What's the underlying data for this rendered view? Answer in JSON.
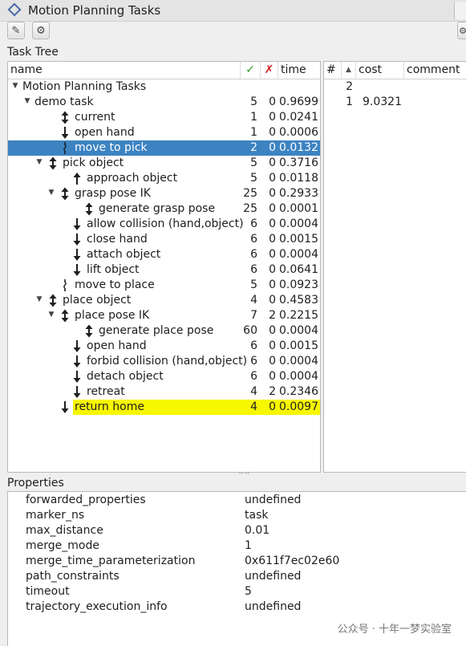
{
  "window": {
    "title": "Motion Planning Tasks"
  },
  "toolbar": {
    "edit_icon": "edit-icon",
    "settings_icon": "gear-icon"
  },
  "task_tree": {
    "label": "Task Tree",
    "columns": {
      "name": "name",
      "ok": "✓",
      "fail": "✗",
      "time": "time"
    },
    "rows": [
      {
        "name": "Motion Planning Tasks",
        "depth": 0,
        "expander": "▼",
        "icon": "",
        "ok": "",
        "fail": "",
        "time": "",
        "state": ""
      },
      {
        "name": "demo task",
        "depth": 1,
        "expander": "▼",
        "icon": "",
        "ok": "5",
        "fail": "0",
        "time": "0.9699",
        "state": ""
      },
      {
        "name": "current",
        "depth": 3,
        "expander": "",
        "icon": "both",
        "ok": "1",
        "fail": "0",
        "time": "0.0241",
        "state": ""
      },
      {
        "name": "open hand",
        "depth": 3,
        "expander": "",
        "icon": "down",
        "ok": "1",
        "fail": "0",
        "time": "0.0006",
        "state": ""
      },
      {
        "name": "move to pick",
        "depth": 3,
        "expander": "",
        "icon": "connect",
        "ok": "2",
        "fail": "0",
        "time": "0.0132",
        "state": "selected"
      },
      {
        "name": "pick object",
        "depth": 2,
        "expander": "▼",
        "icon": "both",
        "ok": "5",
        "fail": "0",
        "time": "0.3716",
        "state": ""
      },
      {
        "name": "approach object",
        "depth": 4,
        "expander": "",
        "icon": "up",
        "ok": "5",
        "fail": "0",
        "time": "0.0118",
        "state": ""
      },
      {
        "name": "grasp pose IK",
        "depth": 3,
        "expander": "▼",
        "icon": "both",
        "ok": "25",
        "fail": "0",
        "time": "0.2933",
        "state": ""
      },
      {
        "name": "generate grasp pose",
        "depth": 5,
        "expander": "",
        "icon": "both",
        "ok": "25",
        "fail": "0",
        "time": "0.0001",
        "state": ""
      },
      {
        "name": "allow collision (hand,object)",
        "depth": 4,
        "expander": "",
        "icon": "down",
        "ok": "6",
        "fail": "0",
        "time": "0.0004",
        "state": ""
      },
      {
        "name": "close hand",
        "depth": 4,
        "expander": "",
        "icon": "down",
        "ok": "6",
        "fail": "0",
        "time": "0.0015",
        "state": ""
      },
      {
        "name": "attach object",
        "depth": 4,
        "expander": "",
        "icon": "down",
        "ok": "6",
        "fail": "0",
        "time": "0.0004",
        "state": ""
      },
      {
        "name": "lift object",
        "depth": 4,
        "expander": "",
        "icon": "down",
        "ok": "6",
        "fail": "0",
        "time": "0.0641",
        "state": ""
      },
      {
        "name": "move to place",
        "depth": 3,
        "expander": "",
        "icon": "connect",
        "ok": "5",
        "fail": "0",
        "time": "0.0923",
        "state": ""
      },
      {
        "name": "place object",
        "depth": 2,
        "expander": "▼",
        "icon": "both",
        "ok": "4",
        "fail": "0",
        "time": "0.4583",
        "state": ""
      },
      {
        "name": "place pose IK",
        "depth": 3,
        "expander": "▼",
        "icon": "both",
        "ok": "7",
        "fail": "2",
        "time": "0.2215",
        "state": ""
      },
      {
        "name": "generate place pose",
        "depth": 5,
        "expander": "",
        "icon": "both",
        "ok": "60",
        "fail": "0",
        "time": "0.0004",
        "state": ""
      },
      {
        "name": "open hand",
        "depth": 4,
        "expander": "",
        "icon": "down",
        "ok": "6",
        "fail": "0",
        "time": "0.0015",
        "state": ""
      },
      {
        "name": "forbid collision (hand,object)",
        "depth": 4,
        "expander": "",
        "icon": "down",
        "ok": "6",
        "fail": "0",
        "time": "0.0004",
        "state": ""
      },
      {
        "name": "detach object",
        "depth": 4,
        "expander": "",
        "icon": "down",
        "ok": "6",
        "fail": "0",
        "time": "0.0004",
        "state": ""
      },
      {
        "name": "retreat",
        "depth": 4,
        "expander": "",
        "icon": "down",
        "ok": "4",
        "fail": "2",
        "time": "0.2346",
        "state": ""
      },
      {
        "name": "return home",
        "depth": 3,
        "expander": "",
        "icon": "down",
        "ok": "4",
        "fail": "0",
        "time": "0.0097",
        "state": "highlighted"
      }
    ]
  },
  "solutions": {
    "columns": {
      "index": "#",
      "sort": "▲",
      "cost": "cost",
      "comment": "comment"
    },
    "rows": [
      {
        "index": "2",
        "cost": "",
        "comment": ""
      },
      {
        "index": "1",
        "cost": "9.0321",
        "comment": ""
      }
    ]
  },
  "properties": {
    "label": "Properties",
    "rows": [
      {
        "key": "forwarded_properties",
        "value": "undefined"
      },
      {
        "key": "marker_ns",
        "value": "task"
      },
      {
        "key": "max_distance",
        "value": "0.01"
      },
      {
        "key": "merge_mode",
        "value": "1"
      },
      {
        "key": "merge_time_parameterization",
        "value": "0x611f7ec02e60"
      },
      {
        "key": "path_constraints",
        "value": "undefined"
      },
      {
        "key": "timeout",
        "value": "5"
      },
      {
        "key": "trajectory_execution_info",
        "value": "undefined"
      }
    ]
  },
  "watermark": "公众号 · 十年一梦实验室",
  "colors": {
    "selection": "#3d83c2",
    "highlight": "#f7f700",
    "ok": "#2e9a2e",
    "fail": "#d42020"
  }
}
